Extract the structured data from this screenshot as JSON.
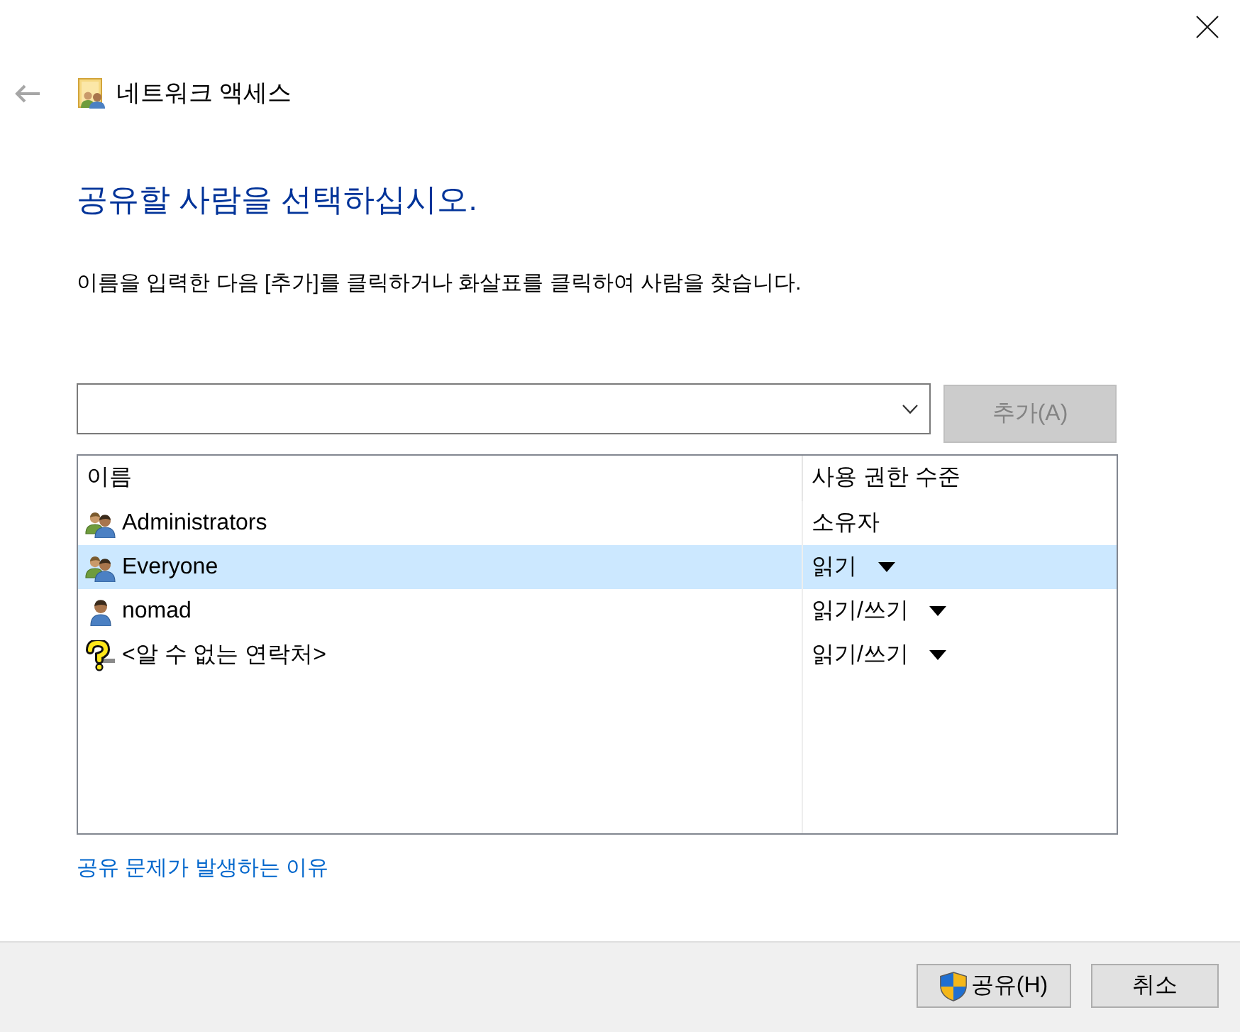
{
  "window": {
    "title": "네트워크 액세스",
    "back_button": {
      "disabled": true
    }
  },
  "heading": "공유할 사람을 선택하십시오.",
  "instruction": "이름을 입력한 다음 [추가]를 클릭하거나 화살표를 클릭하여 사람을 찾습니다.",
  "add_button": {
    "label": "추가(A)",
    "disabled": true
  },
  "table": {
    "columns": [
      "이름",
      "사용 권한 수준"
    ],
    "rows": [
      {
        "kind": "group",
        "name": "Administrators",
        "permission": "소유자",
        "dropdown": false,
        "selected": false
      },
      {
        "kind": "group",
        "name": "Everyone",
        "permission": "읽기",
        "dropdown": true,
        "selected": true
      },
      {
        "kind": "user",
        "name": "nomad",
        "permission": "읽기/쓰기",
        "dropdown": true,
        "selected": false
      },
      {
        "kind": "unknown",
        "name": "<알 수 없는 연락처>",
        "permission": "읽기/쓰기",
        "dropdown": true,
        "selected": false
      }
    ]
  },
  "help_link": "공유 문제가 발생하는 이유",
  "buttons": [
    {
      "label": "공유(H)",
      "kind": "shield"
    },
    {
      "label": "취소",
      "kind": "plain"
    }
  ]
}
